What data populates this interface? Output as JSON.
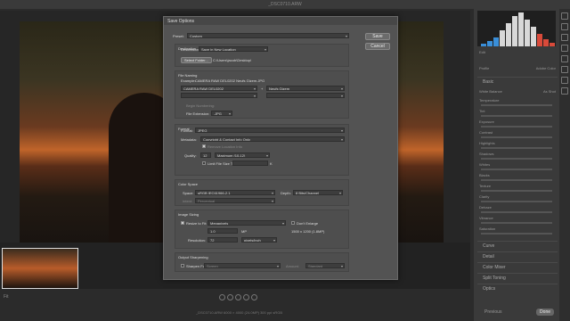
{
  "app": {
    "title": "_DSC0710.ARW"
  },
  "filmstrip": {
    "zoom": "Fit",
    "info": "_DSC0710.ARW  6000 × 4000 (24.0MP)  300 ppi  sRGB"
  },
  "right_panel": {
    "tabs": [
      "Edit"
    ],
    "sections": [
      "Basic",
      "Curve",
      "Detail",
      "Color Mixer",
      "Split Toning",
      "Optics"
    ],
    "sliders": [
      "Temperature",
      "Tint",
      "Exposure",
      "Contrast",
      "Highlights",
      "Shadows",
      "Whites",
      "Blacks",
      "Texture",
      "Clarity",
      "Dehaze",
      "Vibrance",
      "Saturation"
    ],
    "profile_label": "Profile",
    "profile_value": "Adobe Color",
    "white_balance_label": "White Balance",
    "white_balance_value": "As Shot",
    "footer": {
      "left": "Previous",
      "right": "Done"
    },
    "histogram": [
      3,
      6,
      10,
      18,
      26,
      34,
      38,
      30,
      22,
      14,
      8,
      4
    ]
  },
  "dialog": {
    "title": "Save Options",
    "preset_label": "Preset:",
    "preset_value": "Custom",
    "save_button": "Save",
    "cancel_button": "Cancel",
    "destination": {
      "legend": "Destination",
      "destination_label": "Destination:",
      "destination_value": "Save in New Location",
      "select_folder_button": "Select Folder...",
      "folder_path": "C:\\Users\\jacob\\Desktop\\"
    },
    "file_naming": {
      "legend": "File Naming",
      "example_label": "Example:",
      "example_value": "CAMERA RAW DEL0202 Neufs Gizem.JPG",
      "field1": "CAMERA RAW DEL0202",
      "field2": "Neufs Gizem",
      "begin_numbering_label": "Begin Numbering:",
      "file_extension_label": "File Extension:",
      "file_extension_value": ".JPG"
    },
    "format": {
      "legend": "Format",
      "format_label": "Format:",
      "format_value": "JPEG",
      "metadata_label": "Metadata:",
      "metadata_value": "Copyright & Contact Info Only",
      "remove_location_label": "Remove Location Info",
      "quality_label": "Quality:",
      "quality_number": "12",
      "quality_value": "Maximum (10-12)",
      "limit_file_size_label": "Limit File Size To:",
      "limit_unit": "K"
    },
    "color_space": {
      "legend": "Color Space",
      "space_label": "Space:",
      "space_value": "sRGB IEC61966-2.1",
      "depth_label": "Depth:",
      "depth_value": "8 Bits/Channel",
      "intent_label": "Intent:",
      "intent_value": "Perceptual"
    },
    "image_sizing": {
      "legend": "Image Sizing",
      "resize_label": "Resize to Fit:",
      "resize_value": "Megapixels",
      "dont_enlarge_label": "Don't Enlarge",
      "mp_value": "1.0",
      "mp_unit": "MP",
      "dims": "1500 x 1200 (1.8MP)",
      "resolution_label": "Resolution:",
      "resolution_value": "72",
      "resolution_unit": "pixels/inch"
    },
    "output_sharpening": {
      "legend": "Output Sharpening",
      "sharpen_for_label": "Sharpen For:",
      "sharpen_for_value": "Screen",
      "amount_label": "Amount:",
      "amount_value": "Standard"
    }
  }
}
